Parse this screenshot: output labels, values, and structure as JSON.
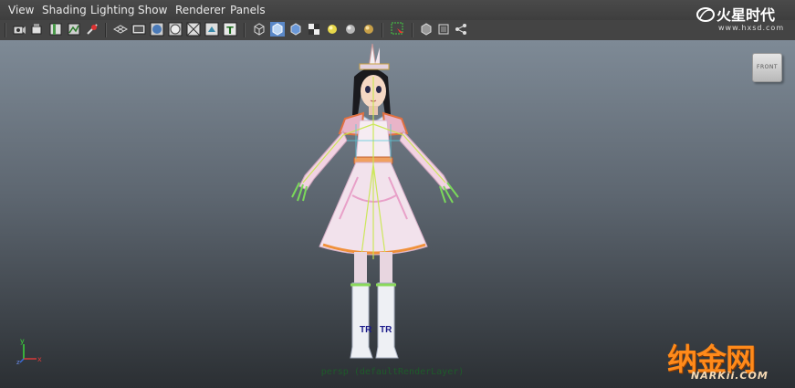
{
  "menu": [
    {
      "label": "View"
    },
    {
      "label": "Shading"
    },
    {
      "label": "Lighting"
    },
    {
      "label": "Show"
    },
    {
      "label": "Renderer"
    },
    {
      "label": "Panels"
    }
  ],
  "toolbar": {
    "icons": [
      "camera-select-icon",
      "camera-attributes-icon",
      "bookmark-icon",
      "image-plane-icon",
      "2d-pan-zoom-icon",
      "grid-icon",
      "film-gate-icon",
      "resolution-gate-icon",
      "gate-mask-icon",
      "field-chart-icon",
      "safe-action-icon",
      "safe-title-icon",
      "wireframe-icon",
      "smooth-shade-icon",
      "flat-shade-icon",
      "textured-icon",
      "use-all-lights-icon",
      "shadows-icon",
      "high-quality-icon",
      "isolate-select-icon",
      "xray-icon",
      "xray-joints-icon",
      "xray-active-icon"
    ]
  },
  "logo": {
    "main": "火星时代",
    "url": "www.hxsd.com"
  },
  "viewport": {
    "view_cube_label": "FRONT",
    "camera_label": "persp (defaultRenderLayer)",
    "axis": {
      "y": "y",
      "x": "x",
      "z": "z"
    },
    "manipulator_labels": [
      "TR",
      "TR"
    ]
  },
  "watermark": {
    "main": "纳金网",
    "sub": "NARKii.COM"
  },
  "colors": {
    "menubar": "#424242",
    "viewport_top": "#7e8a96",
    "viewport_bottom": "#2b2f33",
    "watermark": "#ff8a1a"
  }
}
